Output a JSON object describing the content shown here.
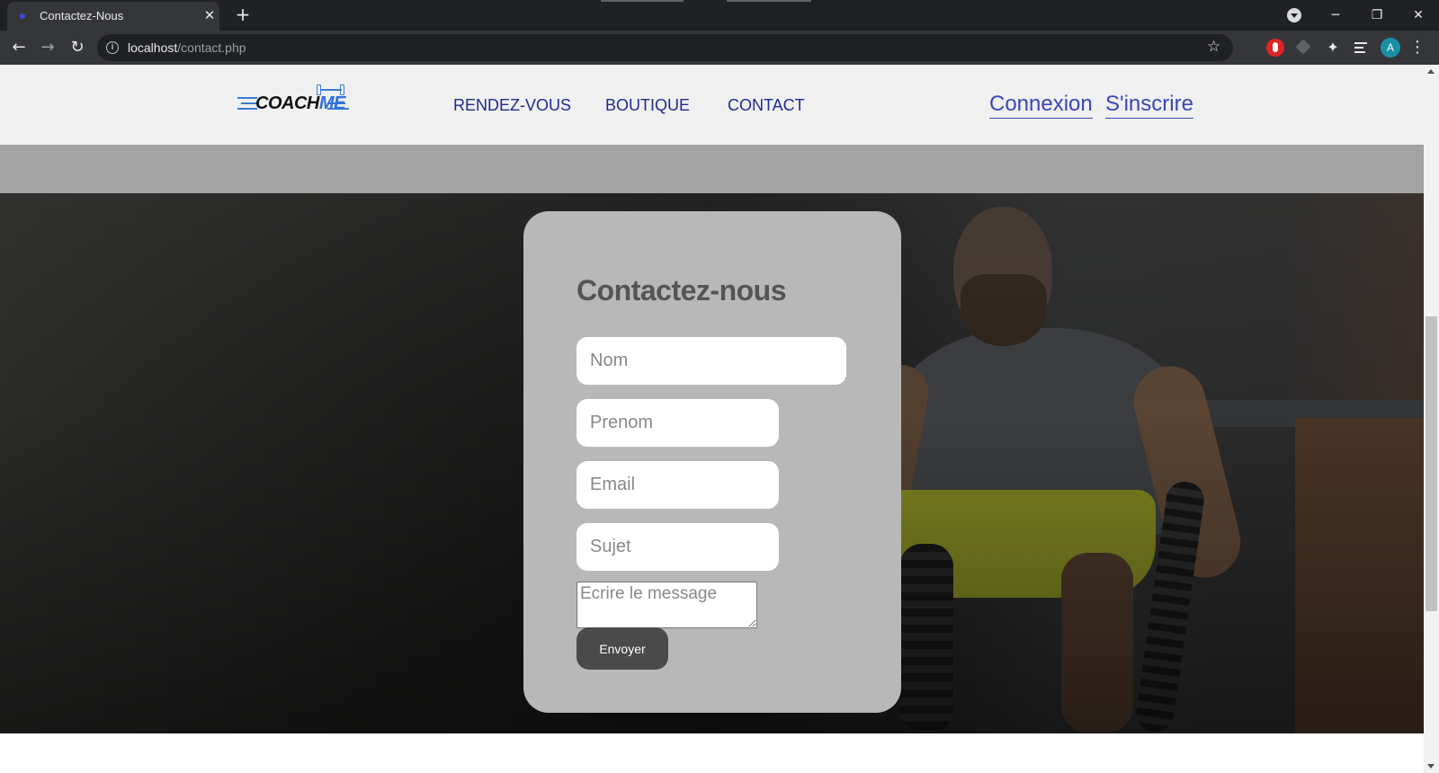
{
  "browser": {
    "tab_title": "Contactez-Nous",
    "tab_close": "✕",
    "new_tab": "+",
    "url_host": "localhost",
    "url_path": "/contact.php",
    "avatar_letter": "A",
    "icons": [
      "favicon",
      "close-icon",
      "plus-icon",
      "back-arrow-icon",
      "forward-arrow-icon",
      "reload-icon",
      "info-icon",
      "star-icon",
      "extension-icons",
      "puzzle-icon",
      "media-control-icon",
      "kebab-menu-icon",
      "minimize-icon",
      "restore-icon",
      "window-close-icon"
    ]
  },
  "site": {
    "logo": {
      "text_main": "COACH",
      "text_accent": "ME"
    },
    "nav": [
      "RENDEZ-VOUS",
      "BOUTIQUE",
      "CONTACT"
    ],
    "auth": {
      "login": "Connexion",
      "signup": "S'inscrire"
    },
    "colors": {
      "nav": "#1e2b8f",
      "auth": "#3b46b8",
      "card": "#b8b8b8",
      "button": "#4a4a4a",
      "header_bg": "#f0f0f0",
      "band": "#a3a3a3"
    }
  },
  "contact_form": {
    "title": "Contactez-nous",
    "fields": {
      "nom": {
        "placeholder": "Nom",
        "value": ""
      },
      "prenom": {
        "placeholder": "Prenom",
        "value": ""
      },
      "email": {
        "placeholder": "Email",
        "value": ""
      },
      "sujet": {
        "placeholder": "Sujet",
        "value": ""
      },
      "message": {
        "placeholder": "Ecrire le message",
        "value": ""
      }
    },
    "submit_label": "Envoyer"
  }
}
